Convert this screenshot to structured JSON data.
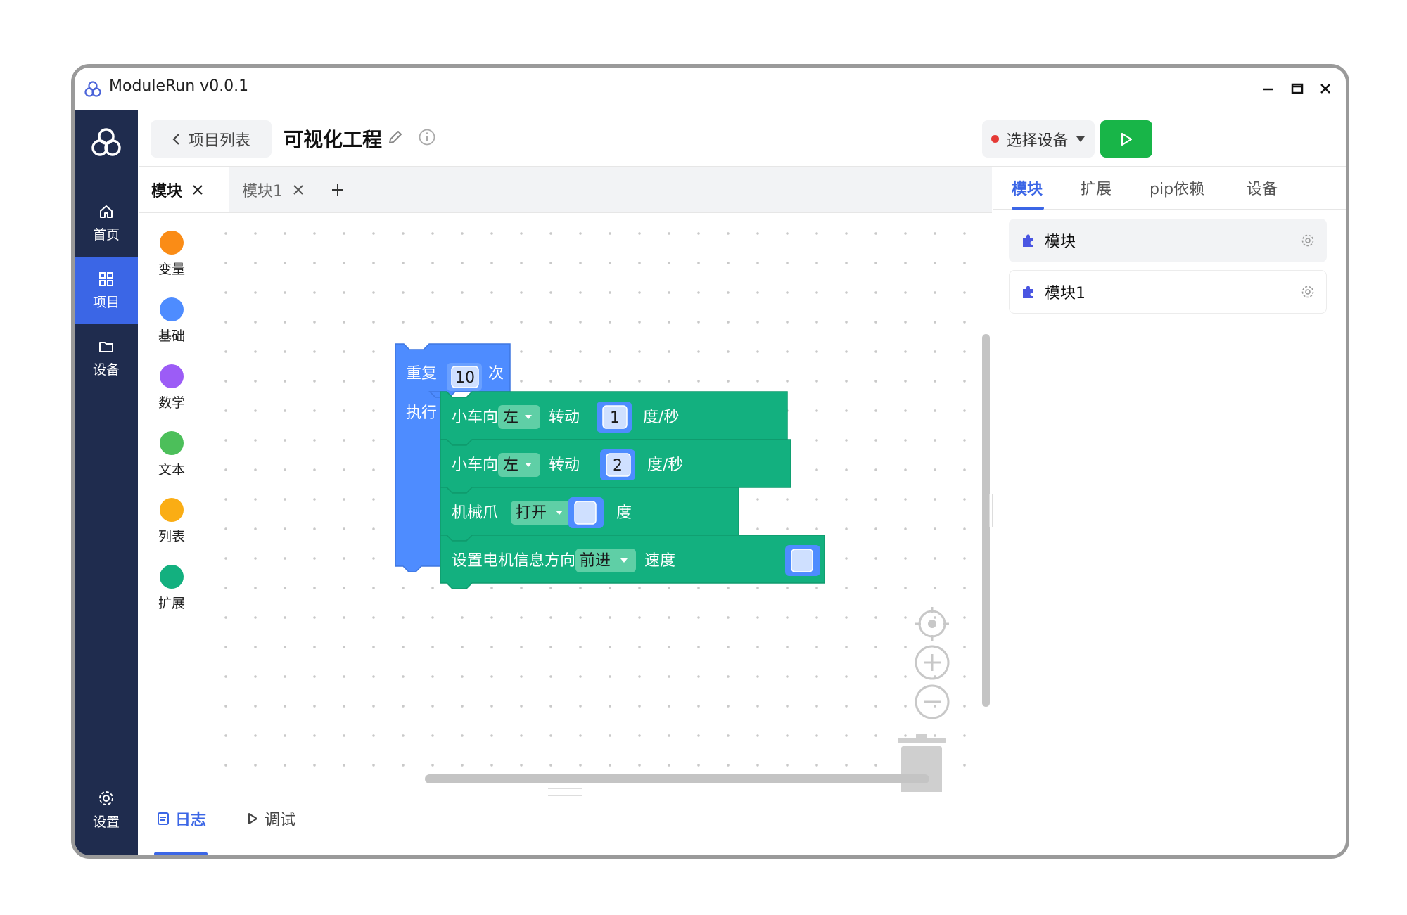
{
  "window": {
    "title": "ModuleRun v0.0.1"
  },
  "nav": {
    "items": [
      {
        "label": "首页",
        "icon": "home-icon"
      },
      {
        "label": "项目",
        "icon": "grid-icon"
      },
      {
        "label": "设备",
        "icon": "folder-icon"
      }
    ],
    "settings_label": "设置",
    "active": "项目",
    "colors": {
      "bg": "#1f2c4e",
      "active": "#3b66e6"
    }
  },
  "header": {
    "back_label": "项目列表",
    "project_title": "可视化工程",
    "device_select_label": "选择设备",
    "run_color": "#18b548"
  },
  "editor_tabs": [
    {
      "label": "模块",
      "active": true
    },
    {
      "label": "模块1",
      "active": false
    }
  ],
  "categories": [
    {
      "label": "变量",
      "color": "#fa8c16"
    },
    {
      "label": "基础",
      "color": "#4e8cff"
    },
    {
      "label": "数学",
      "color": "#9c5cf6"
    },
    {
      "label": "文本",
      "color": "#4cbf5a"
    },
    {
      "label": "列表",
      "color": "#faad14"
    },
    {
      "label": "扩展",
      "color": "#13b07f"
    }
  ],
  "blocks": {
    "repeat": {
      "prefix": "重复",
      "count": "10",
      "suffix": "次",
      "do_label": "执行",
      "color": "#4e8cff"
    },
    "statements": [
      {
        "parts": [
          "小车向",
          "转动",
          "度/秒"
        ],
        "dropdown": "左",
        "value": "1"
      },
      {
        "parts": [
          "小车向",
          "转动",
          "度/秒"
        ],
        "dropdown": "左",
        "value": "2"
      },
      {
        "parts": [
          "机械爪",
          "度"
        ],
        "dropdown": "打开",
        "value": ""
      },
      {
        "parts": [
          "设置电机信息方向",
          "速度"
        ],
        "dropdown": "前进",
        "value": ""
      }
    ],
    "statement_color": "#13b07f"
  },
  "bottom_tabs": [
    {
      "label": "日志",
      "active": true
    },
    {
      "label": "调试",
      "active": false
    }
  ],
  "right_panel": {
    "tabs": [
      {
        "label": "模块",
        "active": true
      },
      {
        "label": "扩展",
        "active": false
      },
      {
        "label": "pip依赖",
        "active": false
      },
      {
        "label": "设备",
        "active": false
      }
    ],
    "modules": [
      {
        "label": "模块",
        "active": true
      },
      {
        "label": "模块1",
        "active": false
      }
    ]
  }
}
